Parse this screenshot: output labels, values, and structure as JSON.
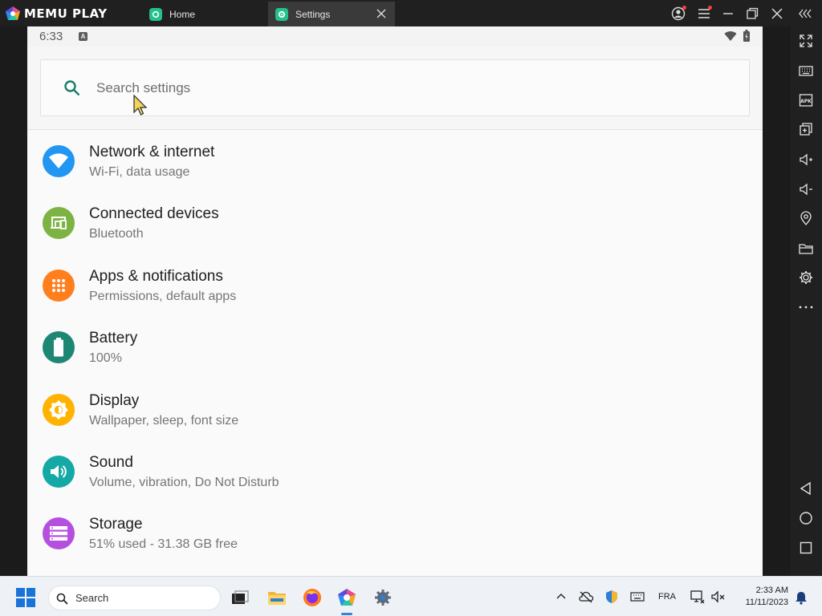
{
  "app": {
    "brand": "MEMU PLAY",
    "tabs": [
      {
        "label": "Home",
        "icon": "home-app-icon",
        "active": false
      },
      {
        "label": "Settings",
        "icon": "settings-app-icon",
        "active": true
      }
    ]
  },
  "android": {
    "status_time": "6:33",
    "status_badge": "A",
    "search": {
      "placeholder": "Search settings"
    },
    "settings": [
      {
        "title": "Network & internet",
        "subtitle": "Wi-Fi, data usage",
        "icon": "wifi-icon",
        "color": "#2196f3"
      },
      {
        "title": "Connected devices",
        "subtitle": "Bluetooth",
        "icon": "devices-icon",
        "color": "#7cb342"
      },
      {
        "title": "Apps & notifications",
        "subtitle": "Permissions, default apps",
        "icon": "apps-grid-icon",
        "color": "#ff7f1f"
      },
      {
        "title": "Battery",
        "subtitle": "100%",
        "icon": "battery-icon",
        "color": "#1e8774"
      },
      {
        "title": "Display",
        "subtitle": "Wallpaper, sleep, font size",
        "icon": "brightness-icon",
        "color": "#ffb300"
      },
      {
        "title": "Sound",
        "subtitle": "Volume, vibration, Do Not Disturb",
        "icon": "volume-icon",
        "color": "#14a9a4"
      },
      {
        "title": "Storage",
        "subtitle": "51% used - 31.38 GB free",
        "icon": "storage-icon",
        "color": "#b54fe0"
      }
    ]
  },
  "taskbar": {
    "search_placeholder": "Search",
    "language": "FRA",
    "time": "2:33 AM",
    "date": "11/11/2023"
  }
}
